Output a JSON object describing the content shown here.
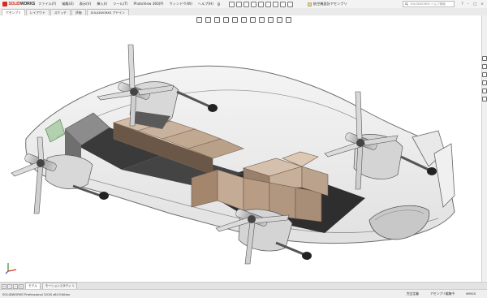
{
  "app": {
    "logo_brand": "SOLID",
    "logo_suffix": "WORKS"
  },
  "menu": [
    "ファイル(F)",
    "編集(E)",
    "表示(V)",
    "挿入(I)",
    "ツール(T)",
    "PhotoView 360(P)",
    "ウィンドウ(W)",
    "ヘルプ(H)"
  ],
  "document_title": "航空機設計アセンブリ",
  "search": {
    "placeholder": "SOLIDWORKS ヘルプ検索"
  },
  "tabs": [
    "アセンブリ",
    "レイアウト",
    "スケッチ",
    "評価",
    "SOLIDWORKS アドイン"
  ],
  "bottom_tabs": [
    "モデル",
    "モーションスタディ 1"
  ],
  "status": {
    "left": "SOLIDWORKS Professional 2018 x64 Edition",
    "middle_1": "完全定義",
    "middle_2": "アセンブリ編集中",
    "units": "MMGS"
  },
  "colors": {
    "accent": "#d52b1e",
    "cargo": "#b59a82",
    "panel_dark": "#3a3a3a"
  }
}
